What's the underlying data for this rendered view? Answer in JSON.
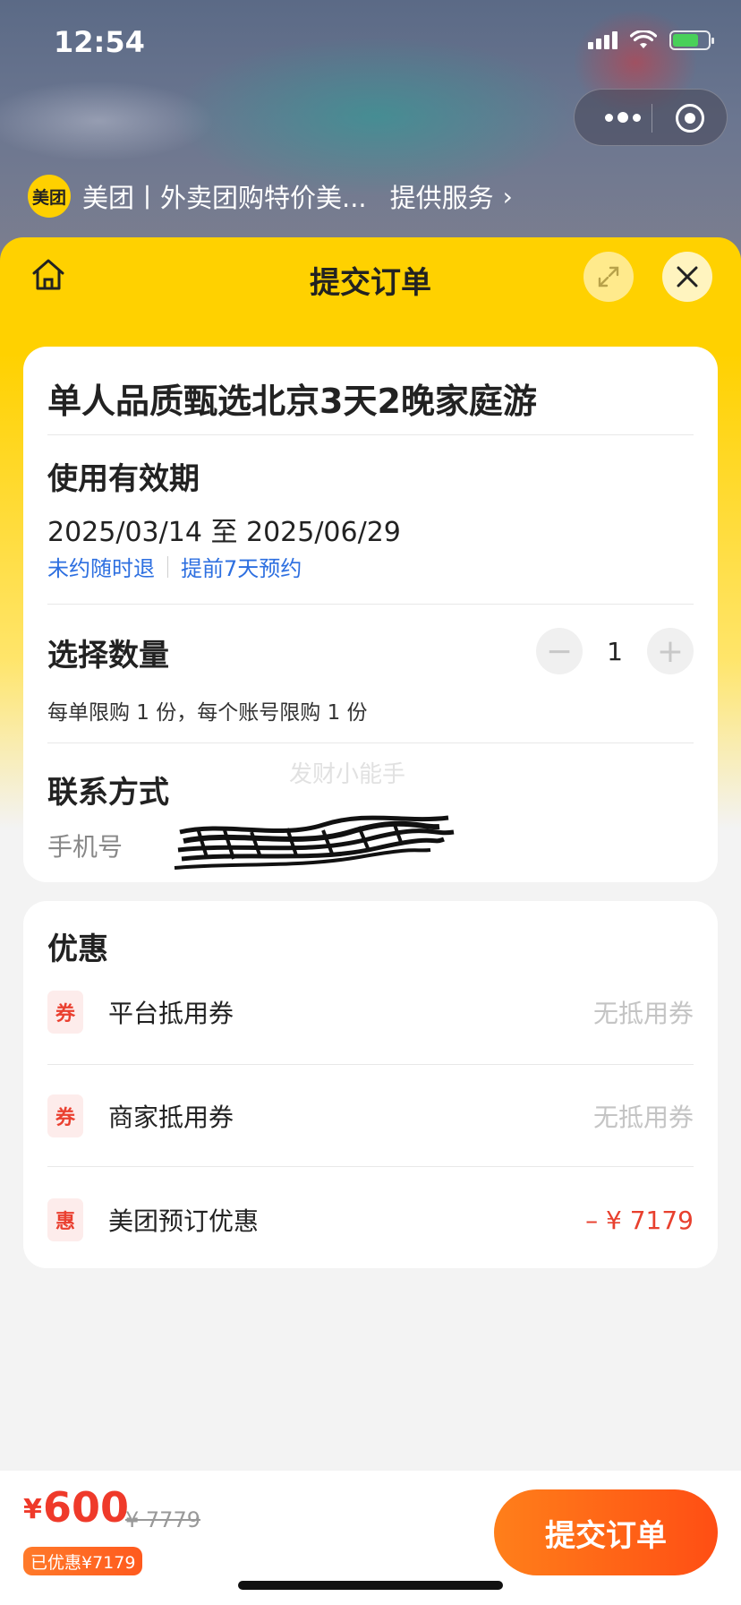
{
  "status_bar": {
    "time": "12:54"
  },
  "mini_program": {
    "logo_text": "美团",
    "name": "美团丨外卖团购特价美...",
    "service_link": "提供服务",
    "service_chevron": "›"
  },
  "sheet": {
    "title": "提交订单"
  },
  "product": {
    "title": "单人品质甄选北京3天2晚家庭游"
  },
  "validity": {
    "heading": "使用有效期",
    "dates": "2025/03/14 至 2025/06/29",
    "policy_refund": "未约随时退",
    "policy_booking": "提前7天预约"
  },
  "quantity": {
    "heading": "选择数量",
    "minus_label": "−",
    "value": "1",
    "plus_label": "+",
    "note": "每单限购 1 份，每个账号限购 1 份"
  },
  "contact": {
    "heading": "联系方式",
    "phone_label": "手机号",
    "watermark": "发财小能手"
  },
  "discounts": {
    "heading": "优惠",
    "rows": [
      {
        "tag": "券",
        "label": "平台抵用券",
        "value": "无抵用券"
      },
      {
        "tag": "券",
        "label": "商家抵用券",
        "value": "无抵用券"
      },
      {
        "tag": "惠",
        "label": "美团预订优惠",
        "value": "– ¥ 7179"
      }
    ]
  },
  "footer": {
    "currency": "¥",
    "price": "600",
    "original_price": "¥ 7779",
    "saved_badge": "已优惠¥7179",
    "submit_label": "提交订单"
  },
  "colors": {
    "brand_yellow": "#ffd100",
    "accent_orange": "#ff5a1e",
    "price_red": "#ef3a2a",
    "link_blue": "#2d6fe0"
  }
}
